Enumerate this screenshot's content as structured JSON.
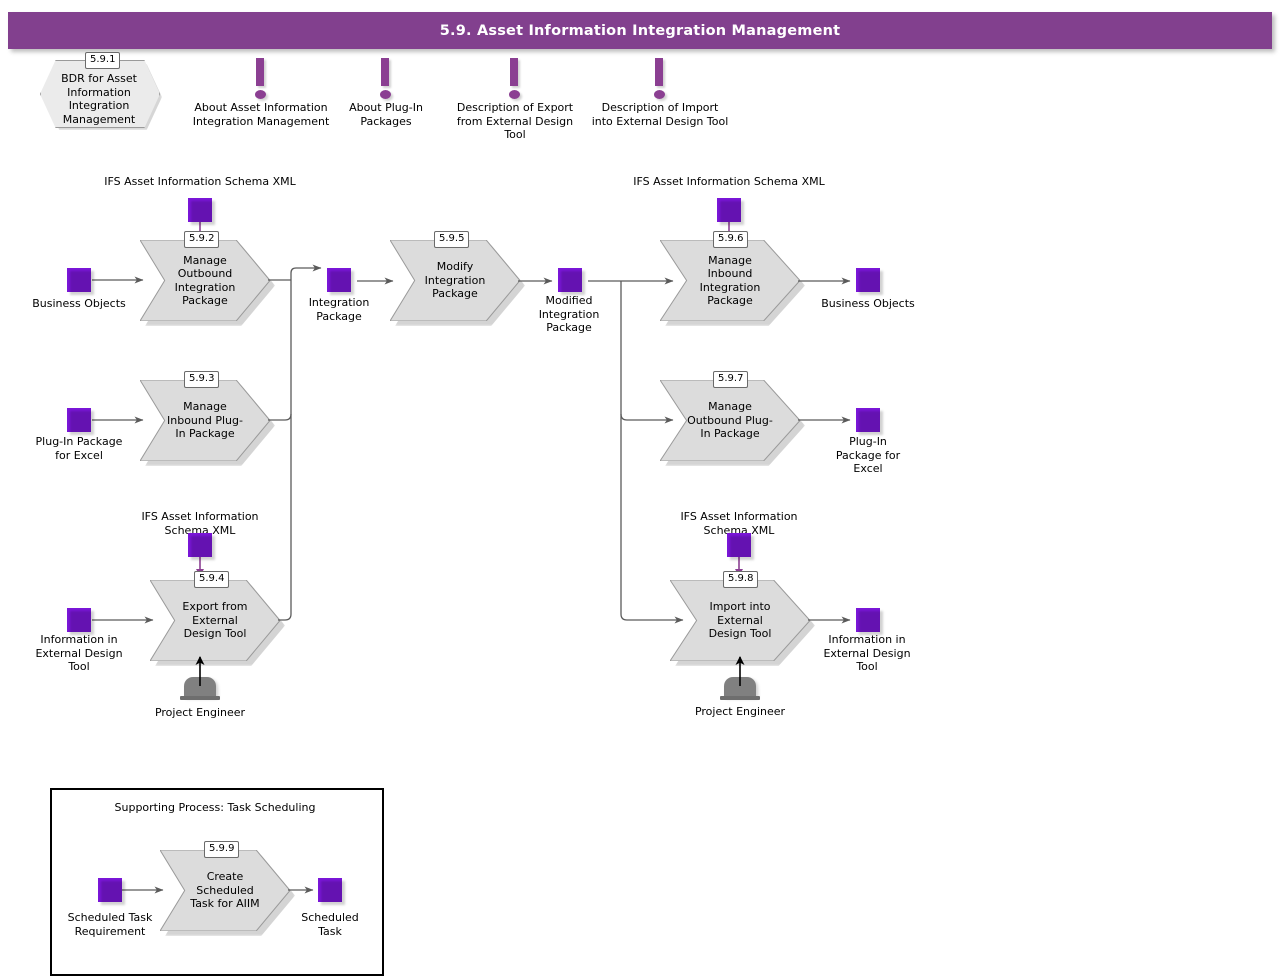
{
  "header": {
    "title": "5.9. Asset Information Integration Management",
    "bar_color": "#82408E"
  },
  "palette": {
    "process_fill": "#DCDCDC",
    "process_stroke": "#9A9A9A",
    "data_node": "#7A16D8",
    "info_marker": "#8B3F92",
    "actor": "#808080",
    "connector": "#5A5A5A"
  },
  "bdr": {
    "id": "5.9.1",
    "label": "BDR for Asset Information Integration Management"
  },
  "info_markers": [
    {
      "name": "about-aiim",
      "label": "About Asset Information Integration Management"
    },
    {
      "name": "about-plugin-packages",
      "label": "About Plug-In Packages"
    },
    {
      "name": "description-export",
      "label": "Description of Export from External Design Tool"
    },
    {
      "name": "description-import",
      "label": "Description of Import into External Design Tool"
    }
  ],
  "group_labels": {
    "schema_top_left": "IFS Asset Information Schema XML",
    "schema_top_right": "IFS Asset Information Schema XML",
    "schema_bottom_left": "IFS Asset Information Schema XML",
    "schema_bottom_right": "IFS Asset Information Schema XML"
  },
  "processes": [
    {
      "id": "5.9.2",
      "label": "Manage Outbound Integration Package"
    },
    {
      "id": "5.9.3",
      "label": "Manage Inbound Plug-In Package"
    },
    {
      "id": "5.9.4",
      "label": "Export from External Design Tool"
    },
    {
      "id": "5.9.5",
      "label": "Modify Integration Package"
    },
    {
      "id": "5.9.6",
      "label": "Manage Inbound Integration Package"
    },
    {
      "id": "5.9.7",
      "label": "Manage Outbound Plug-In Package"
    },
    {
      "id": "5.9.8",
      "label": "Import into External Design Tool"
    },
    {
      "id": "5.9.9",
      "label": "Create Scheduled Task for AIIM"
    }
  ],
  "data_nodes": {
    "business_objects_in": "Business Objects",
    "plugin_package_excel_in": "Plug-In Package for Excel",
    "information_external_in": "Information in External Design Tool",
    "integration_package": "Integration Package",
    "modified_integration_package": "Modified Integration Package",
    "business_objects_out": "Business Objects",
    "plugin_package_excel_out": "Plug-In Package for Excel",
    "information_external_out": "Information in External Design Tool",
    "scheduled_task_requirement": "Scheduled Task Requirement",
    "scheduled_task": "Scheduled Task"
  },
  "actors": {
    "left": "Project Engineer",
    "right": "Project Engineer"
  },
  "supporting_process": {
    "title": "Supporting Process: Task Scheduling"
  }
}
